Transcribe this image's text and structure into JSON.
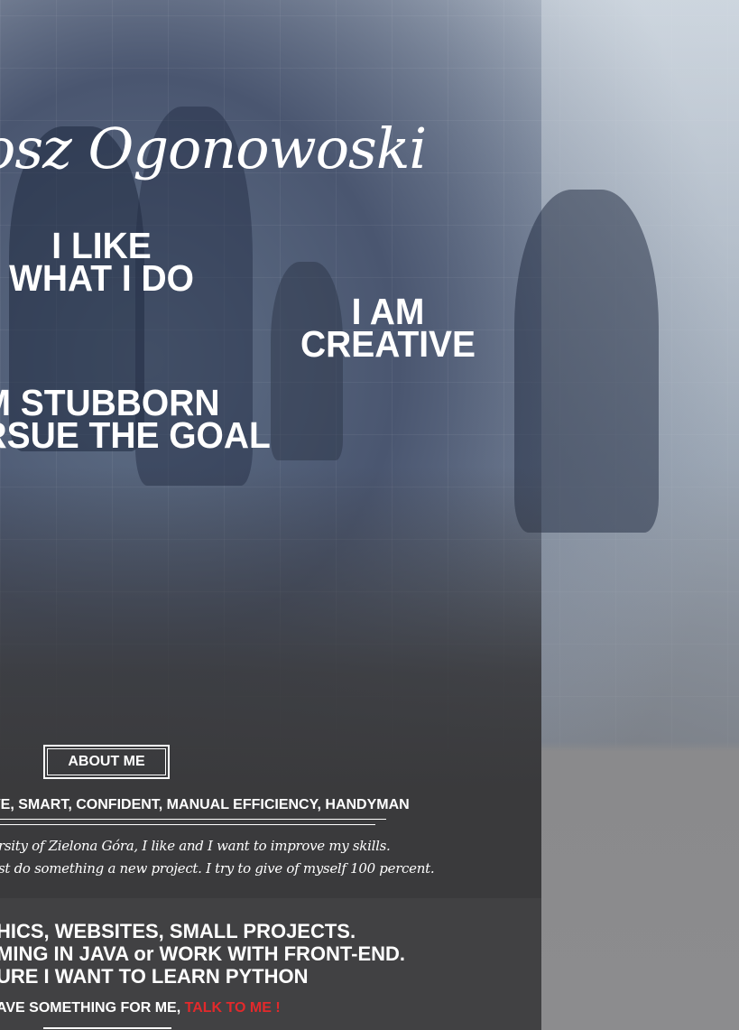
{
  "header": {
    "name": "osz Ogonowoski"
  },
  "slogans": {
    "like_line1": "I LIKE",
    "like_line2": "WHAT I DO",
    "creative_line1": "I AM",
    "creative_line2": "CREATIVE",
    "stubborn_line1": "M STUBBORN",
    "stubborn_line2": "RSUE THE GOAL"
  },
  "about": {
    "button_label": "ABOUT ME",
    "traits": "VE, SMART, CONFIDENT, MANUAL EFFICIENCY, HANDYMAN",
    "bio_line1": "rsity of Zielona Góra, I like and I want to improve my skills.",
    "bio_line2": "st do something a new project. I try to give of myself 100 percent."
  },
  "skills": {
    "line1": "HICS, WEBSITES, SMALL PROJECTS.",
    "line2": "MING IN JAVA or WORK WITH FRONT-END.",
    "line3": "URE I WANT TO LEARN PYTHON"
  },
  "contact": {
    "prefix": "AVE SOMETHING FOR ME, ",
    "link": "TALK TO ME !"
  },
  "colors": {
    "accent": "#e3292b",
    "panel": "#3a3a3c",
    "text": "#ffffff"
  }
}
